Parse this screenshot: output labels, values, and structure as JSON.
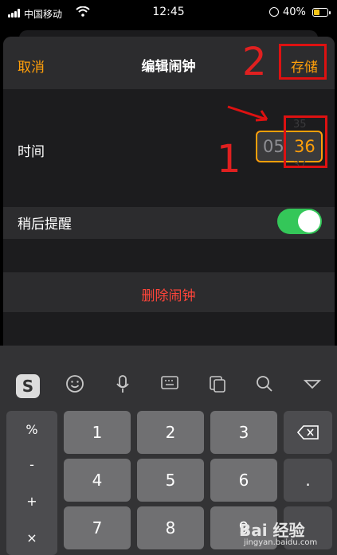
{
  "status_bar": {
    "carrier": "中国移动",
    "time": "12:45",
    "battery_percent": "40%"
  },
  "nav": {
    "cancel": "取消",
    "title": "编辑闹钟",
    "save": "存储"
  },
  "time_row": {
    "label": "时间",
    "hour": "05",
    "minute": "36",
    "minute_prev": "35",
    "minute_next": "37"
  },
  "snooze_row": {
    "label": "稍后提醒",
    "enabled": true
  },
  "delete": {
    "label": "删除闹钟"
  },
  "annotations": {
    "num1": "1",
    "num2": "2"
  },
  "keyboard": {
    "symbols": [
      "%",
      "-",
      "+",
      "×"
    ],
    "keys": [
      [
        "1",
        "2",
        "3"
      ],
      [
        "4",
        "5",
        "6"
      ],
      [
        "7",
        "8",
        "9"
      ]
    ],
    "dot": ".",
    "toolbar_icons": [
      "sogou-logo-icon",
      "emoji-icon",
      "microphone-icon",
      "keyboard-icon",
      "clipboard-icon",
      "search-icon",
      "collapse-icon"
    ]
  },
  "watermark": {
    "text": "Bai 经验",
    "sub": "jingyan.baidu.com"
  }
}
